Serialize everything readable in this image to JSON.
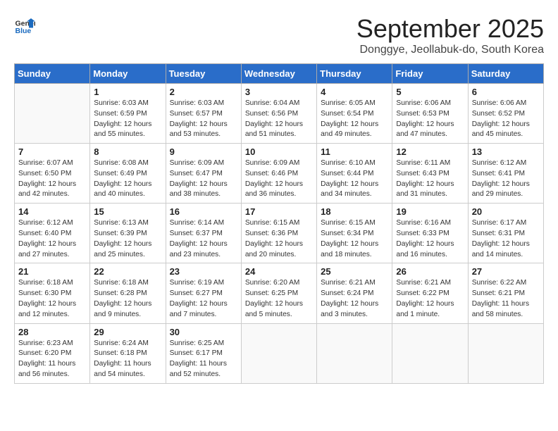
{
  "header": {
    "logo_line1": "General",
    "logo_line2": "Blue",
    "month": "September 2025",
    "location": "Donggye, Jeollabuk-do, South Korea"
  },
  "weekdays": [
    "Sunday",
    "Monday",
    "Tuesday",
    "Wednesday",
    "Thursday",
    "Friday",
    "Saturday"
  ],
  "weeks": [
    [
      {
        "day": "",
        "info": ""
      },
      {
        "day": "1",
        "info": "Sunrise: 6:03 AM\nSunset: 6:59 PM\nDaylight: 12 hours\nand 55 minutes."
      },
      {
        "day": "2",
        "info": "Sunrise: 6:03 AM\nSunset: 6:57 PM\nDaylight: 12 hours\nand 53 minutes."
      },
      {
        "day": "3",
        "info": "Sunrise: 6:04 AM\nSunset: 6:56 PM\nDaylight: 12 hours\nand 51 minutes."
      },
      {
        "day": "4",
        "info": "Sunrise: 6:05 AM\nSunset: 6:54 PM\nDaylight: 12 hours\nand 49 minutes."
      },
      {
        "day": "5",
        "info": "Sunrise: 6:06 AM\nSunset: 6:53 PM\nDaylight: 12 hours\nand 47 minutes."
      },
      {
        "day": "6",
        "info": "Sunrise: 6:06 AM\nSunset: 6:52 PM\nDaylight: 12 hours\nand 45 minutes."
      }
    ],
    [
      {
        "day": "7",
        "info": "Sunrise: 6:07 AM\nSunset: 6:50 PM\nDaylight: 12 hours\nand 42 minutes."
      },
      {
        "day": "8",
        "info": "Sunrise: 6:08 AM\nSunset: 6:49 PM\nDaylight: 12 hours\nand 40 minutes."
      },
      {
        "day": "9",
        "info": "Sunrise: 6:09 AM\nSunset: 6:47 PM\nDaylight: 12 hours\nand 38 minutes."
      },
      {
        "day": "10",
        "info": "Sunrise: 6:09 AM\nSunset: 6:46 PM\nDaylight: 12 hours\nand 36 minutes."
      },
      {
        "day": "11",
        "info": "Sunrise: 6:10 AM\nSunset: 6:44 PM\nDaylight: 12 hours\nand 34 minutes."
      },
      {
        "day": "12",
        "info": "Sunrise: 6:11 AM\nSunset: 6:43 PM\nDaylight: 12 hours\nand 31 minutes."
      },
      {
        "day": "13",
        "info": "Sunrise: 6:12 AM\nSunset: 6:41 PM\nDaylight: 12 hours\nand 29 minutes."
      }
    ],
    [
      {
        "day": "14",
        "info": "Sunrise: 6:12 AM\nSunset: 6:40 PM\nDaylight: 12 hours\nand 27 minutes."
      },
      {
        "day": "15",
        "info": "Sunrise: 6:13 AM\nSunset: 6:39 PM\nDaylight: 12 hours\nand 25 minutes."
      },
      {
        "day": "16",
        "info": "Sunrise: 6:14 AM\nSunset: 6:37 PM\nDaylight: 12 hours\nand 23 minutes."
      },
      {
        "day": "17",
        "info": "Sunrise: 6:15 AM\nSunset: 6:36 PM\nDaylight: 12 hours\nand 20 minutes."
      },
      {
        "day": "18",
        "info": "Sunrise: 6:15 AM\nSunset: 6:34 PM\nDaylight: 12 hours\nand 18 minutes."
      },
      {
        "day": "19",
        "info": "Sunrise: 6:16 AM\nSunset: 6:33 PM\nDaylight: 12 hours\nand 16 minutes."
      },
      {
        "day": "20",
        "info": "Sunrise: 6:17 AM\nSunset: 6:31 PM\nDaylight: 12 hours\nand 14 minutes."
      }
    ],
    [
      {
        "day": "21",
        "info": "Sunrise: 6:18 AM\nSunset: 6:30 PM\nDaylight: 12 hours\nand 12 minutes."
      },
      {
        "day": "22",
        "info": "Sunrise: 6:18 AM\nSunset: 6:28 PM\nDaylight: 12 hours\nand 9 minutes."
      },
      {
        "day": "23",
        "info": "Sunrise: 6:19 AM\nSunset: 6:27 PM\nDaylight: 12 hours\nand 7 minutes."
      },
      {
        "day": "24",
        "info": "Sunrise: 6:20 AM\nSunset: 6:25 PM\nDaylight: 12 hours\nand 5 minutes."
      },
      {
        "day": "25",
        "info": "Sunrise: 6:21 AM\nSunset: 6:24 PM\nDaylight: 12 hours\nand 3 minutes."
      },
      {
        "day": "26",
        "info": "Sunrise: 6:21 AM\nSunset: 6:22 PM\nDaylight: 12 hours\nand 1 minute."
      },
      {
        "day": "27",
        "info": "Sunrise: 6:22 AM\nSunset: 6:21 PM\nDaylight: 11 hours\nand 58 minutes."
      }
    ],
    [
      {
        "day": "28",
        "info": "Sunrise: 6:23 AM\nSunset: 6:20 PM\nDaylight: 11 hours\nand 56 minutes."
      },
      {
        "day": "29",
        "info": "Sunrise: 6:24 AM\nSunset: 6:18 PM\nDaylight: 11 hours\nand 54 minutes."
      },
      {
        "day": "30",
        "info": "Sunrise: 6:25 AM\nSunset: 6:17 PM\nDaylight: 11 hours\nand 52 minutes."
      },
      {
        "day": "",
        "info": ""
      },
      {
        "day": "",
        "info": ""
      },
      {
        "day": "",
        "info": ""
      },
      {
        "day": "",
        "info": ""
      }
    ]
  ]
}
